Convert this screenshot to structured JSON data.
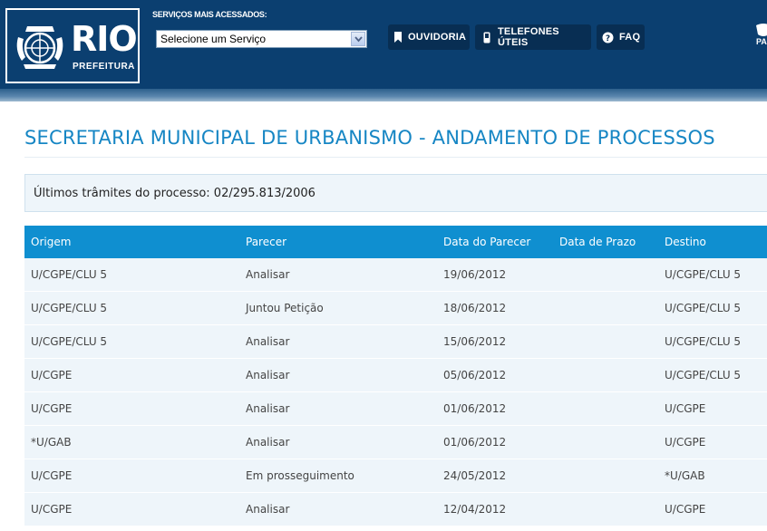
{
  "header": {
    "logo": {
      "word": "RIO",
      "sub": "PREFEITURA"
    },
    "services_label": "SERVIÇOS MAIS ACESSADOS:",
    "service_select": {
      "value": "Selecione um Serviço"
    },
    "nav": [
      {
        "label": "OUVIDORIA",
        "icon": "bookmark-icon"
      },
      {
        "label": "TELEFONES ÚTEIS",
        "icon": "phone-icon"
      },
      {
        "label": "FAQ",
        "icon": "question-icon"
      }
    ],
    "corner_label": "PA"
  },
  "main": {
    "title": "SECRETARIA MUNICIPAL DE URBANISMO - ANDAMENTO DE PROCESSOS",
    "process_label": "Últimos trâmites do processo: 02/295.813/2006",
    "table": {
      "columns": [
        "Origem",
        "Parecer",
        "Data do Parecer",
        "Data de Prazo",
        "Destino"
      ],
      "rows": [
        [
          "U/CGPE/CLU 5",
          "Analisar",
          "19/06/2012",
          "",
          "U/CGPE/CLU 5"
        ],
        [
          "U/CGPE/CLU 5",
          "Juntou Petição",
          "18/06/2012",
          "",
          "U/CGPE/CLU 5"
        ],
        [
          "U/CGPE/CLU 5",
          "Analisar",
          "15/06/2012",
          "",
          "U/CGPE/CLU 5"
        ],
        [
          "U/CGPE",
          "Analisar",
          "05/06/2012",
          "",
          "U/CGPE/CLU 5"
        ],
        [
          "U/CGPE",
          "Analisar",
          "01/06/2012",
          "",
          "U/CGPE"
        ],
        [
          "*U/GAB",
          "Analisar",
          "01/06/2012",
          "",
          "U/CGPE"
        ],
        [
          "U/CGPE",
          "Em prosseguimento",
          "24/05/2012",
          "",
          "*U/GAB"
        ],
        [
          "U/CGPE",
          "Analisar",
          "12/04/2012",
          "",
          "U/CGPE"
        ]
      ]
    }
  },
  "colors": {
    "header_bg": "#0b3f70",
    "title": "#1686c4",
    "table_header": "#0f8fd0",
    "row_bg": "#eef5fa"
  }
}
